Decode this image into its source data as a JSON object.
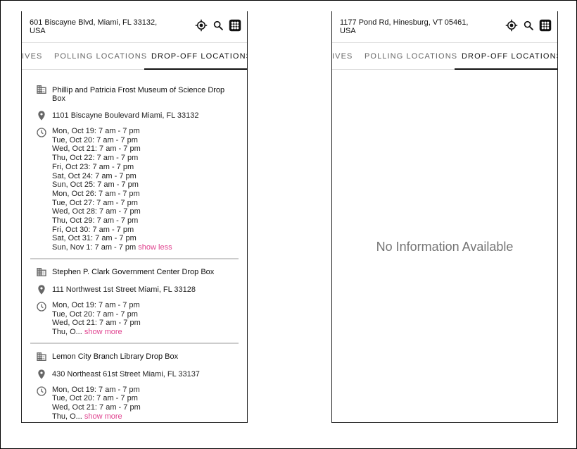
{
  "left": {
    "address": "601 Biscayne Blvd, Miami, FL 33132, USA",
    "tabs": [
      "IVES",
      "POLLING LOCATIONS",
      "DROP-OFF LOCATIONS"
    ],
    "places": [
      {
        "name": "Phillip and Patricia Frost Museum of Science Drop Box",
        "address": "1101 Biscayne Boulevard Miami, FL 33132",
        "hours": [
          "Mon, Oct 19: 7 am - 7 pm",
          "Tue, Oct 20: 7 am - 7 pm",
          "Wed, Oct 21: 7 am - 7 pm",
          "Thu, Oct 22: 7 am - 7 pm",
          "Fri, Oct 23: 7 am - 7 pm",
          "Sat, Oct 24: 7 am - 7 pm",
          "Sun, Oct 25: 7 am - 7 pm",
          "Mon, Oct 26: 7 am - 7 pm",
          "Tue, Oct 27: 7 am - 7 pm",
          "Wed, Oct 28: 7 am - 7 pm",
          "Thu, Oct 29: 7 am - 7 pm",
          "Fri, Oct 30: 7 am - 7 pm",
          "Sat, Oct 31: 7 am - 7 pm",
          "Sun, Nov 1: 7 am - 7 pm"
        ],
        "toggle": "show less"
      },
      {
        "name": "Stephen P. Clark Government Center Drop Box",
        "address": "111 Northwest 1st Street Miami, FL 33128",
        "hours": [
          "Mon, Oct 19: 7 am - 7 pm",
          "Tue, Oct 20: 7 am - 7 pm",
          "Wed, Oct 21: 7 am - 7 pm",
          "Thu, O..."
        ],
        "toggle": "show more"
      },
      {
        "name": "Lemon City Branch Library Drop Box",
        "address": "430 Northeast 61st Street Miami, FL 33137",
        "hours": [
          "Mon, Oct 19: 7 am - 7 pm",
          "Tue, Oct 20: 7 am - 7 pm",
          "Wed, Oct 21: 7 am - 7 pm",
          "Thu, O..."
        ],
        "toggle": "show more"
      }
    ]
  },
  "right": {
    "address": "1177 Pond Rd, Hinesburg, VT 05461, USA",
    "tabs": [
      "IVES",
      "POLLING LOCATIONS",
      "DROP-OFF LOCATIONS"
    ],
    "empty_message": "No Information Available"
  },
  "icons": {
    "locate": "crosshairs-locate-icon",
    "search": "search-icon",
    "apps": "apps-grid-icon",
    "building": "building-icon",
    "pin": "location-pin-icon",
    "clock": "clock-icon"
  },
  "colors": {
    "toggle_link": "#e0438f",
    "empty_text": "#757575"
  }
}
